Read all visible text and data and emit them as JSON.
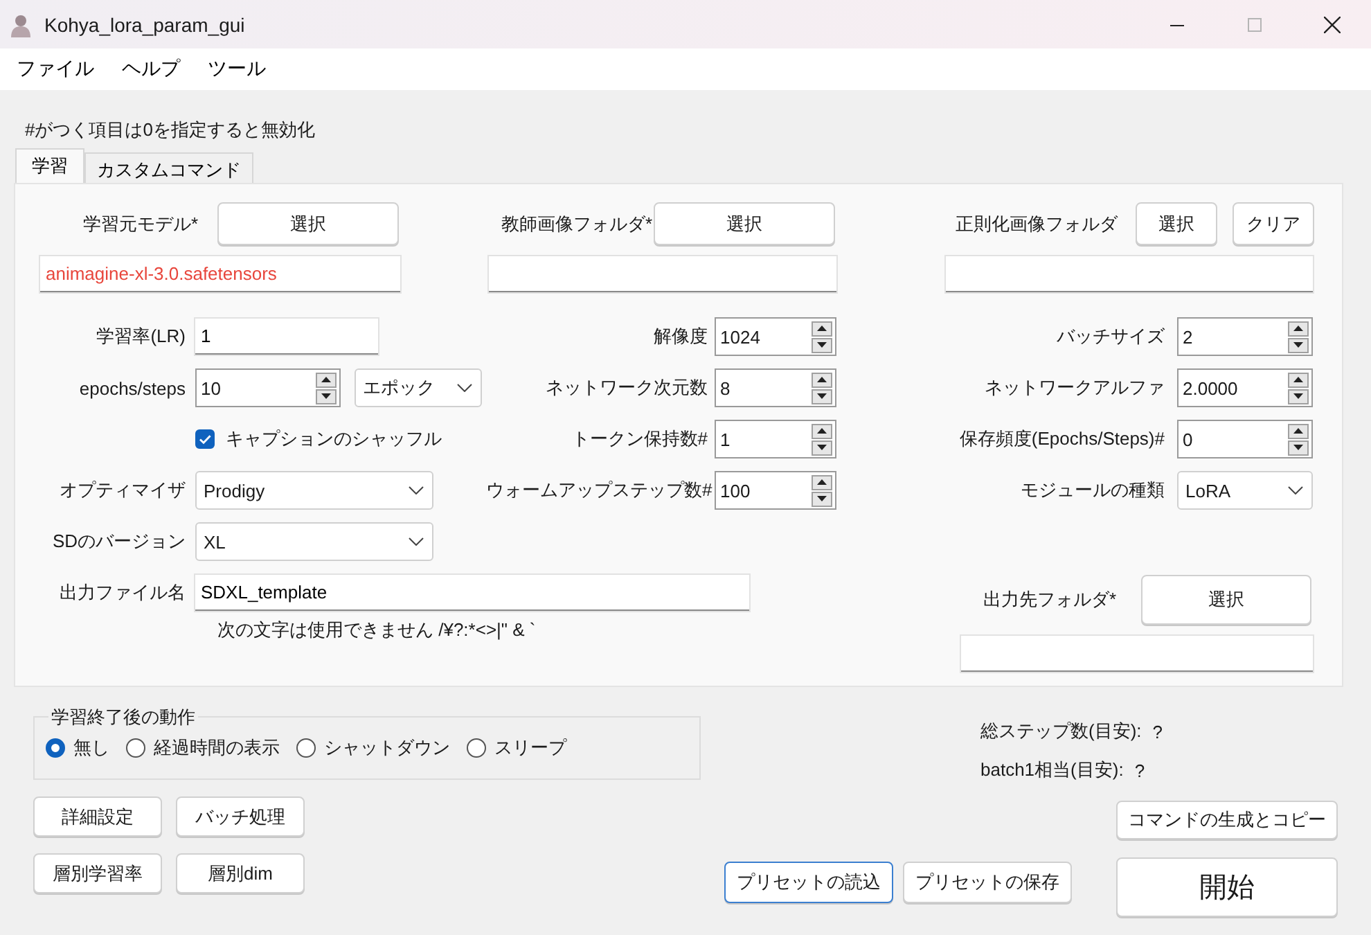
{
  "window": {
    "title": "Kohya_lora_param_gui"
  },
  "menu": [
    "ファイル",
    "ヘルプ",
    "ツール"
  ],
  "note": "#がつく項目は0を指定すると無効化",
  "tabs": [
    {
      "label": "学習",
      "selected": true
    },
    {
      "label": "カスタムコマンド",
      "selected": false
    }
  ],
  "folders": [
    {
      "label": "学習元モデル*",
      "buttons": [
        "選択"
      ],
      "value": "animagine-xl-3.0.safetensors",
      "color": "#e8463c"
    },
    {
      "label": "教師画像フォルダ*",
      "buttons": [
        "選択"
      ]
    },
    {
      "label": "正則化画像フォルダ",
      "buttons": [
        "選択",
        "クリア"
      ]
    }
  ],
  "column_1": [
    {
      "kind": "text",
      "label": "学習率(LR)",
      "value": "1"
    },
    {
      "kind": "spin_combo",
      "label": "epochs/steps",
      "value": "10",
      "option": "エポック"
    },
    {
      "kind": "checkbox",
      "label": "キャプションのシャッフル",
      "checked": true
    },
    {
      "kind": "combo",
      "label": "オプティマイザ",
      "value": "Prodigy"
    },
    {
      "kind": "combo",
      "label": "SDのバージョン",
      "value": "XL"
    },
    {
      "kind": "text",
      "label": "出力ファイル名",
      "value": "SDXL_template",
      "hint": "次の文字は使用できません /¥?:*<>|\" & `"
    }
  ],
  "column_2": [
    {
      "kind": "spin",
      "label": "解像度",
      "value": "1024"
    },
    {
      "kind": "spin",
      "label": "ネットワーク次元数",
      "value": "8"
    },
    {
      "kind": "spin",
      "label": "トークン保持数#",
      "value": "1"
    },
    {
      "kind": "spin",
      "label": "ウォームアップステップ数#",
      "value": "100"
    }
  ],
  "column_3": [
    {
      "kind": "spin",
      "label": "バッチサイズ",
      "value": "2"
    },
    {
      "kind": "spin",
      "label": "ネットワークアルファ",
      "value": "2.0000"
    },
    {
      "kind": "spin",
      "label": "保存頻度(Epochs/Steps)#",
      "value": "0"
    },
    {
      "kind": "combo",
      "label": "モジュールの種類",
      "value": "LoRA"
    }
  ],
  "output_folder": {
    "label": "出力先フォルダ*",
    "button": "選択"
  },
  "after_training": {
    "title": "学習終了後の動作",
    "options": [
      {
        "label": "無し",
        "selected": true
      },
      {
        "label": "経過時間の表示",
        "selected": false
      },
      {
        "label": "シャットダウン",
        "selected": false
      },
      {
        "label": "スリープ",
        "selected": false
      }
    ]
  },
  "tool_buttons": [
    [
      "詳細設定",
      "バッチ処理"
    ],
    [
      "層別学習率",
      "層別dim"
    ]
  ],
  "estimates": [
    {
      "label": "総ステップ数(目安):",
      "value": "?"
    },
    {
      "label": "batch1相当(目安):",
      "value": "?"
    }
  ],
  "command_button": "コマンドの生成とコピー",
  "preset_buttons": [
    {
      "label": "プリセットの読込",
      "focused": true
    },
    {
      "label": "プリセットの保存",
      "focused": false
    }
  ],
  "start_button": "開始"
}
